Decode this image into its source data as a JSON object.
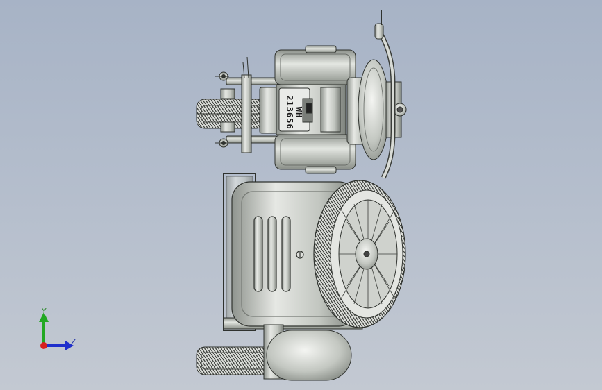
{
  "model": {
    "name_plate": {
      "line1": "WH",
      "line2": "213656"
    }
  },
  "triad": {
    "y_label": "Y",
    "z_label": "Z",
    "colors": {
      "y": "#22a822",
      "z": "#1f2fcc",
      "origin": "#d81f1f"
    }
  },
  "colors": {
    "background_top": "#a7b3c6",
    "background_bottom": "#c3c9d2",
    "metal": "#c9cdc8",
    "tire": "#d4d6d2"
  }
}
